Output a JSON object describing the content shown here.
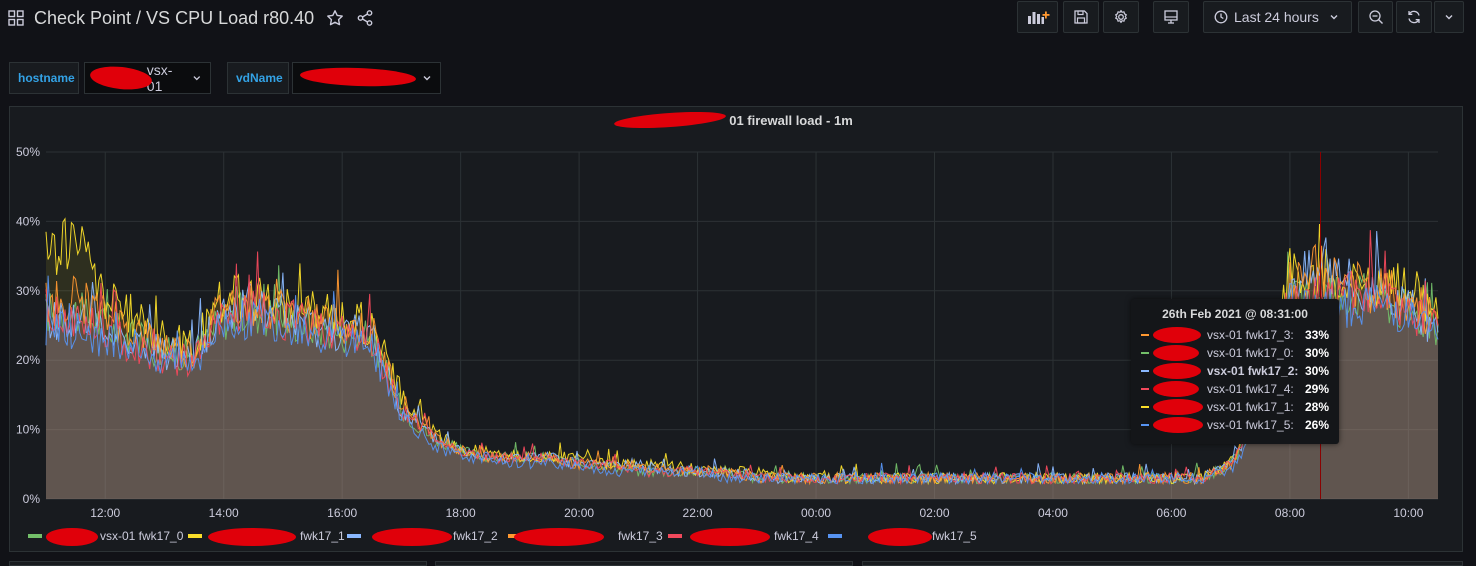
{
  "dashboard": {
    "title": "Check Point / VS CPU Load r80.40",
    "time_range": "Last 24 hours"
  },
  "variables": [
    {
      "label": "hostname",
      "value": "vsx-01"
    },
    {
      "label": "vdName",
      "value": ""
    }
  ],
  "panel": {
    "title": "01 firewall load - 1m"
  },
  "tooltip": {
    "time": "26th Feb 2021 @ 08:31:00",
    "rows": [
      {
        "name": "vsx-01 fwk17_3:",
        "value": "33%",
        "color": "#ff9830",
        "bold": false
      },
      {
        "name": "vsx-01 fwk17_0:",
        "value": "30%",
        "color": "#73bf69",
        "bold": false
      },
      {
        "name": "vsx-01 fwk17_2:",
        "value": "30%",
        "color": "#8ab8ff",
        "bold": true
      },
      {
        "name": "vsx-01 fwk17_4:",
        "value": "29%",
        "color": "#f2495c",
        "bold": false
      },
      {
        "name": "vsx-01 fwk17_1:",
        "value": "28%",
        "color": "#fade2a",
        "bold": false
      },
      {
        "name": "vsx-01 fwk17_5:",
        "value": "26%",
        "color": "#5794f2",
        "bold": false
      }
    ]
  },
  "legend": [
    {
      "name": "vsx-01 fwk17_0",
      "color": "#73bf69"
    },
    {
      "name": "fwk17_1",
      "color": "#fade2a"
    },
    {
      "name": "fwk17_2",
      "color": "#8ab8ff"
    },
    {
      "name": "fwk17_3",
      "color": "#ff9830"
    },
    {
      "name": "fwk17_4",
      "color": "#f2495c"
    },
    {
      "name": "fwk17_5",
      "color": "#5794f2"
    }
  ],
  "chart_data": {
    "type": "line",
    "x": [
      "11:00",
      "11:30",
      "12:00",
      "12:30",
      "13:00",
      "13:30",
      "14:00",
      "14:30",
      "15:00",
      "15:30",
      "16:00",
      "16:30",
      "17:00",
      "17:30",
      "18:00",
      "18:30",
      "19:00",
      "19:30",
      "20:00",
      "20:30",
      "21:00",
      "21:30",
      "22:00",
      "22:30",
      "23:00",
      "23:30",
      "00:00",
      "00:30",
      "01:00",
      "01:30",
      "02:00",
      "02:30",
      "03:00",
      "03:30",
      "04:00",
      "04:30",
      "05:00",
      "05:30",
      "06:00",
      "06:30",
      "07:00",
      "07:30",
      "08:00",
      "08:30",
      "09:00",
      "09:30",
      "10:00",
      "10:30"
    ],
    "xticks": [
      "12:00",
      "14:00",
      "16:00",
      "18:00",
      "20:00",
      "22:00",
      "00:00",
      "02:00",
      "04:00",
      "06:00",
      "08:00",
      "10:00"
    ],
    "yticks": [
      "0%",
      "10%",
      "20%",
      "30%",
      "40%",
      "50%"
    ],
    "ylim": [
      0,
      50
    ],
    "grid": true,
    "legend_position": "bottom",
    "series": [
      {
        "name": "vsx-01 fwk17_0",
        "color": "#73bf69",
        "values": [
          27,
          27,
          25,
          23,
          21,
          21,
          26,
          27,
          26,
          25,
          24,
          23,
          13,
          9,
          7,
          6,
          6,
          6,
          5,
          5,
          4,
          4,
          4,
          4,
          3,
          3,
          3,
          3,
          3,
          3,
          3,
          3,
          3,
          3,
          3,
          3,
          3,
          3,
          3,
          3,
          5,
          12,
          28,
          30,
          30,
          29,
          27,
          25
        ]
      },
      {
        "name": "fwk17_1",
        "color": "#fade2a",
        "values": [
          35,
          38,
          29,
          26,
          23,
          22,
          29,
          29,
          28,
          27,
          26,
          25,
          15,
          10,
          7,
          7,
          6,
          6,
          6,
          5,
          5,
          5,
          4,
          4,
          4,
          3,
          3,
          3,
          3,
          3,
          3,
          3,
          3,
          3,
          3,
          3,
          3,
          3,
          3,
          3,
          5,
          13,
          33,
          31,
          31,
          31,
          31,
          26
        ]
      },
      {
        "name": "fwk17_2",
        "color": "#8ab8ff",
        "values": [
          26,
          26,
          24,
          23,
          21,
          21,
          27,
          28,
          26,
          25,
          24,
          24,
          13,
          9,
          7,
          6,
          6,
          6,
          5,
          5,
          5,
          4,
          4,
          4,
          3,
          3,
          3,
          3,
          3,
          3,
          3,
          3,
          3,
          3,
          3,
          3,
          3,
          3,
          3,
          3,
          5,
          12,
          30,
          35,
          31,
          30,
          28,
          24
        ]
      },
      {
        "name": "fwk17_3",
        "color": "#ff9830",
        "values": [
          28,
          29,
          26,
          24,
          22,
          21,
          28,
          28,
          27,
          26,
          25,
          24,
          14,
          9,
          7,
          6,
          6,
          6,
          5,
          5,
          5,
          4,
          4,
          4,
          3,
          3,
          3,
          3,
          3,
          3,
          3,
          3,
          3,
          3,
          3,
          3,
          3,
          3,
          3,
          3,
          5,
          13,
          31,
          33,
          31,
          30,
          29,
          25
        ]
      },
      {
        "name": "fwk17_4",
        "color": "#f2495c",
        "values": [
          27,
          26,
          24,
          22,
          20,
          20,
          26,
          27,
          26,
          25,
          24,
          23,
          13,
          9,
          7,
          6,
          6,
          6,
          5,
          5,
          4,
          4,
          4,
          4,
          3,
          3,
          3,
          3,
          3,
          3,
          3,
          3,
          3,
          3,
          3,
          3,
          3,
          3,
          3,
          3,
          5,
          12,
          29,
          29,
          30,
          29,
          27,
          25
        ]
      },
      {
        "name": "fwk17_5",
        "color": "#5794f2",
        "values": [
          25,
          24,
          23,
          22,
          20,
          20,
          25,
          26,
          25,
          24,
          23,
          22,
          12,
          8,
          6,
          6,
          5,
          5,
          5,
          4,
          4,
          4,
          4,
          3,
          3,
          3,
          3,
          3,
          3,
          3,
          3,
          3,
          3,
          3,
          3,
          3,
          3,
          3,
          3,
          3,
          4,
          11,
          28,
          27,
          28,
          28,
          26,
          23
        ]
      }
    ]
  }
}
